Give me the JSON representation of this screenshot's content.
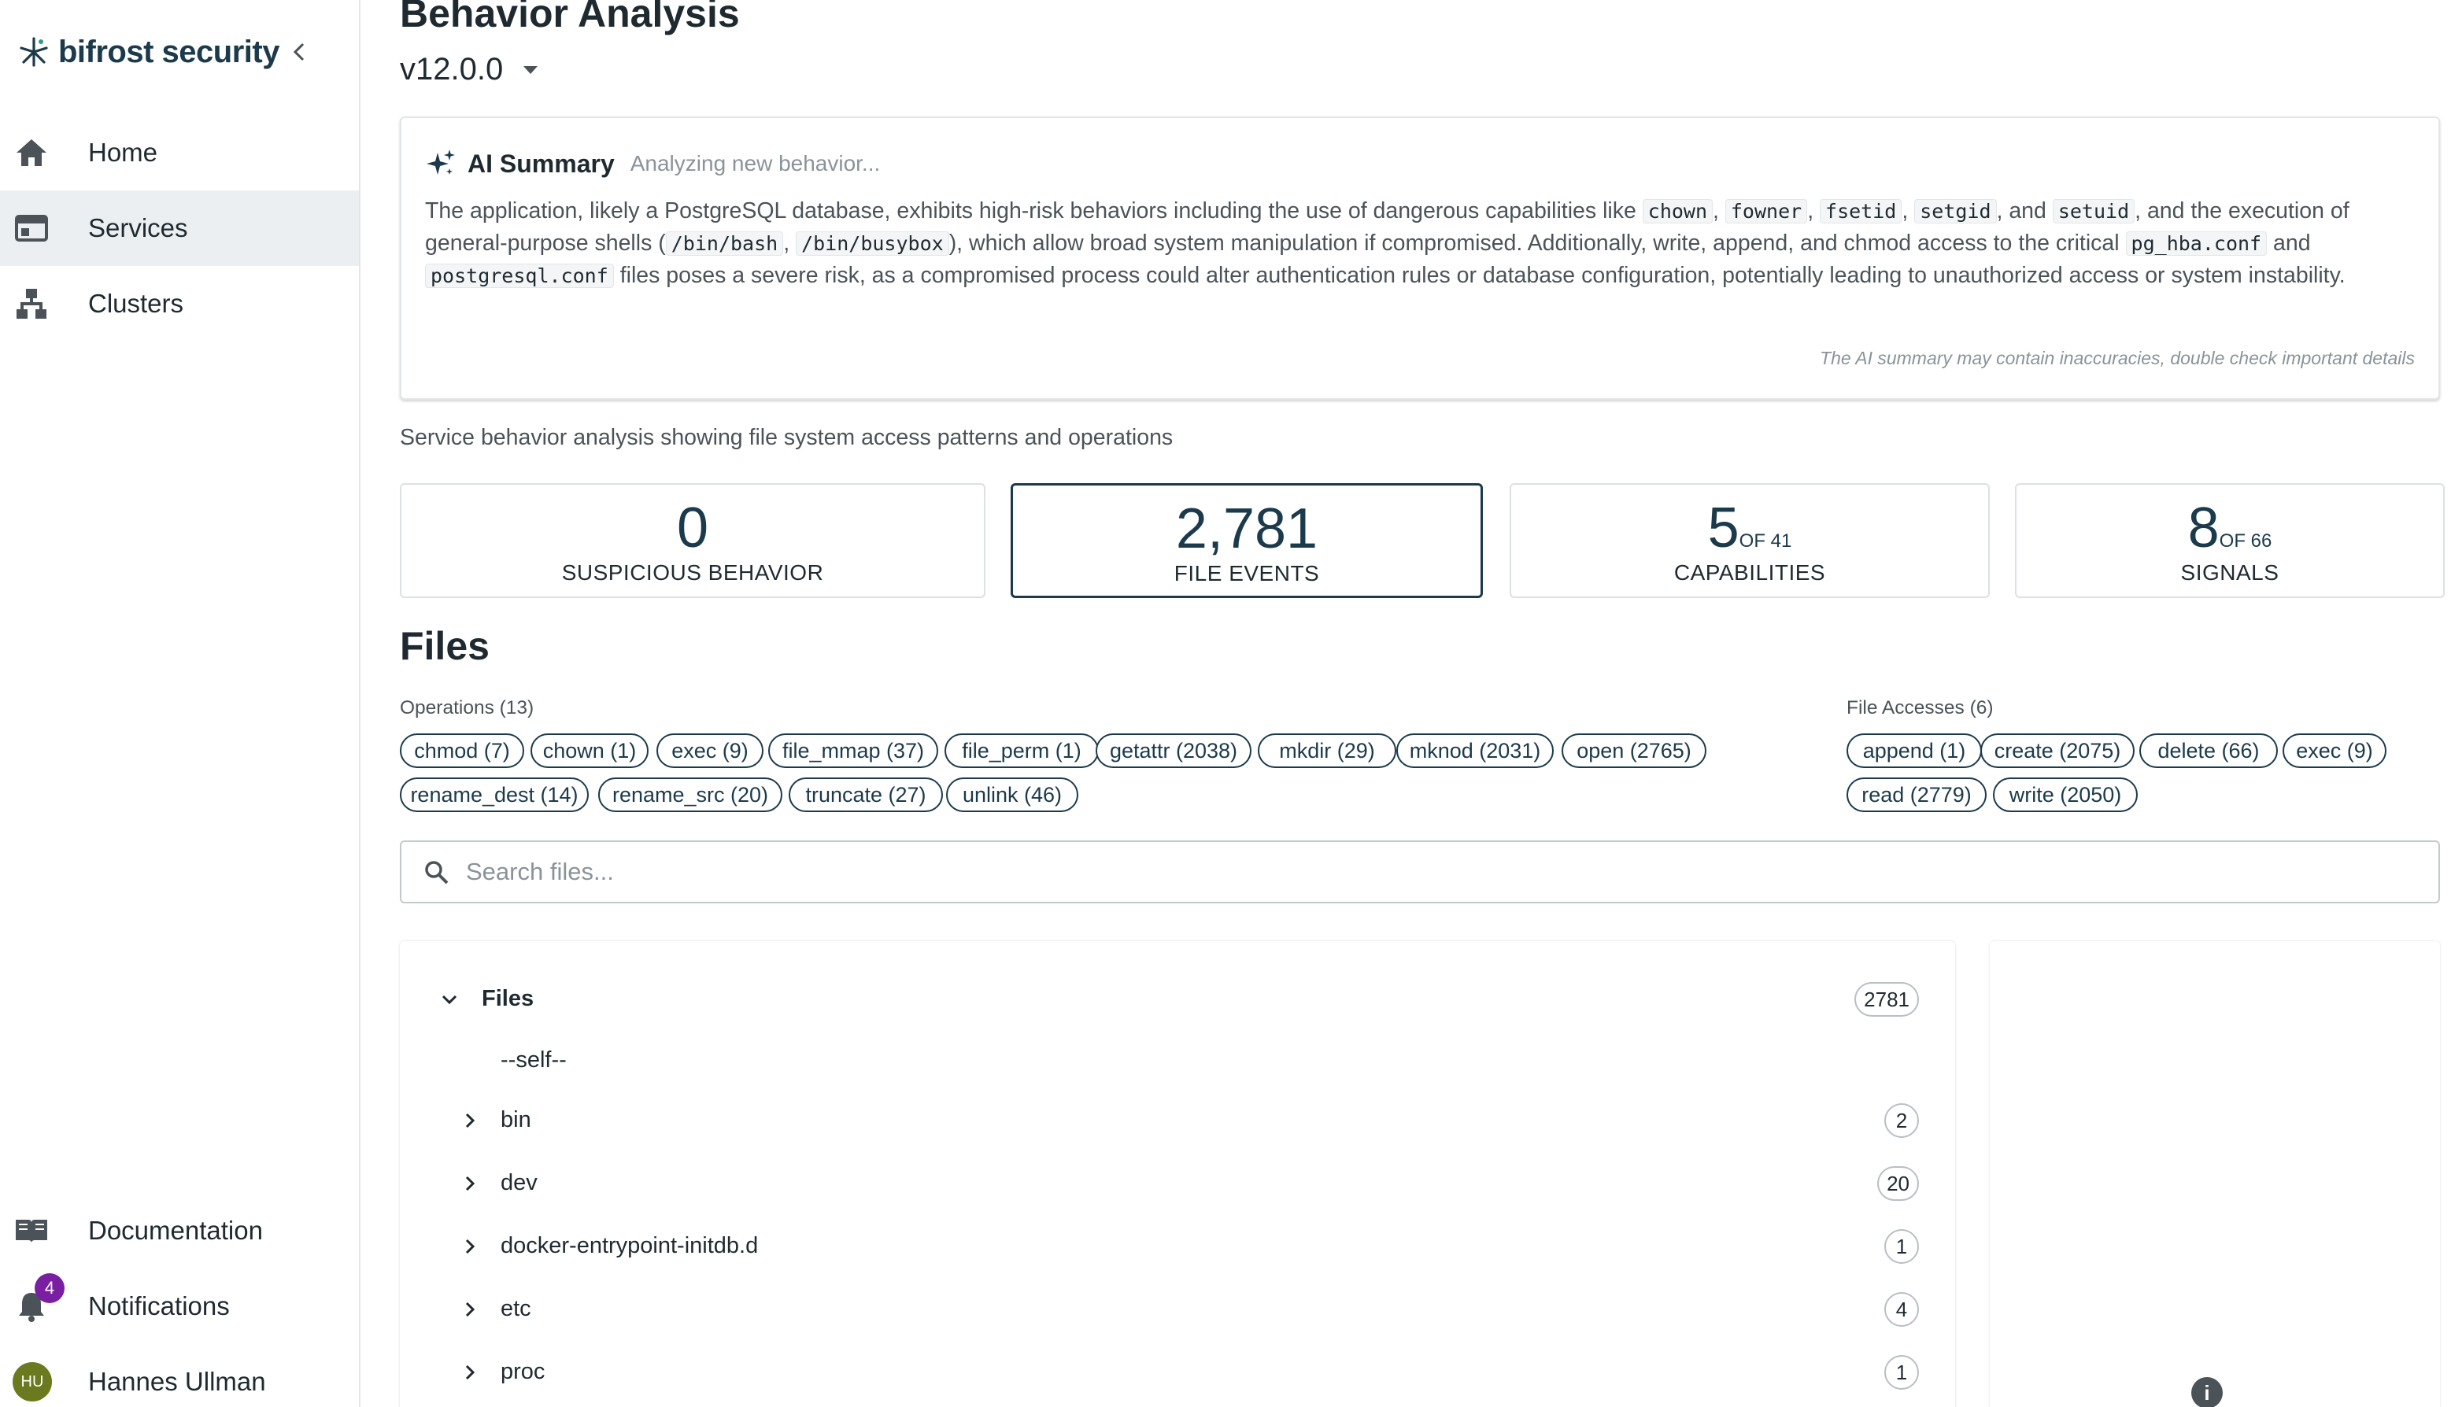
{
  "sidebar": {
    "brand": "bifrost security",
    "nav": [
      {
        "label": "Home",
        "icon": "home-icon"
      },
      {
        "label": "Services",
        "icon": "services-icon",
        "active": true
      },
      {
        "label": "Clusters",
        "icon": "clusters-icon"
      }
    ],
    "bottom": {
      "documentation": "Documentation",
      "notifications": "Notifications",
      "notifications_count": "4",
      "user_initials": "HU",
      "user_name": "Hannes Ullman"
    }
  },
  "header": {
    "title": "Behavior Analysis",
    "version": "v12.0.0"
  },
  "ai_summary": {
    "title": "AI Summary",
    "status": "Analyzing new behavior...",
    "text": {
      "p1": "The application, likely a PostgreSQL database, exhibits high-risk behaviors including the use of dangerous capabilities like",
      "cap1": "chown",
      "cap2": "fowner",
      "cap3": "fsetid",
      "cap4": "setgid",
      "and1": ", and",
      "cap5": "setuid",
      "p2": ", and the execution of general-purpose shells (",
      "shell1": "/bin/bash",
      "shell2": "/bin/busybox",
      "p3": "), which allow broad system manipulation if compromised. Additionally, write, append, and chmod access to the critical",
      "file1": "pg_hba.conf",
      "and2": "and",
      "file2": "postgresql.conf",
      "p4": "files poses a severe risk, as a compromised process could alter authentication rules or database configuration, potentially leading to unauthorized access or system instability."
    },
    "disclaimer": "The AI summary may contain inaccuracies, double check important details"
  },
  "description": "Service behavior analysis showing file system access patterns and operations",
  "stats": [
    {
      "value": "0",
      "of": "",
      "label": "SUSPICIOUS BEHAVIOR"
    },
    {
      "value": "2,781",
      "of": "",
      "label": "FILE EVENTS",
      "active": true
    },
    {
      "value": "5",
      "of": "OF 41",
      "label": "CAPABILITIES"
    },
    {
      "value": "8",
      "of": "OF 66",
      "label": "SIGNALS"
    }
  ],
  "files": {
    "title": "Files",
    "operations_label": "Operations (13)",
    "operations": [
      "chmod (7)",
      "chown (1)",
      "exec (9)",
      "file_mmap (37)",
      "file_perm (1)",
      "getattr (2038)",
      "mkdir (29)",
      "mknod (2031)",
      "open (2765)",
      "rename_dest (14)",
      "rename_src (20)",
      "truncate (27)",
      "unlink (46)"
    ],
    "accesses_label": "File Accesses (6)",
    "accesses": [
      "append (1)",
      "create (2075)",
      "delete (66)",
      "exec (9)",
      "read (2779)",
      "write (2050)"
    ],
    "search_placeholder": "Search files...",
    "tree": {
      "root": {
        "label": "Files",
        "count": "2781"
      },
      "self": "--self--",
      "items": [
        {
          "label": "bin",
          "count": "2"
        },
        {
          "label": "dev",
          "count": "20"
        },
        {
          "label": "docker-entrypoint-initdb.d",
          "count": "1"
        },
        {
          "label": "etc",
          "count": "4"
        },
        {
          "label": "proc",
          "count": "1"
        }
      ]
    }
  },
  "colors": {
    "brand": "#1b3a4b",
    "badge": "#7b1fa2",
    "avatar": "#6b7a1e"
  }
}
